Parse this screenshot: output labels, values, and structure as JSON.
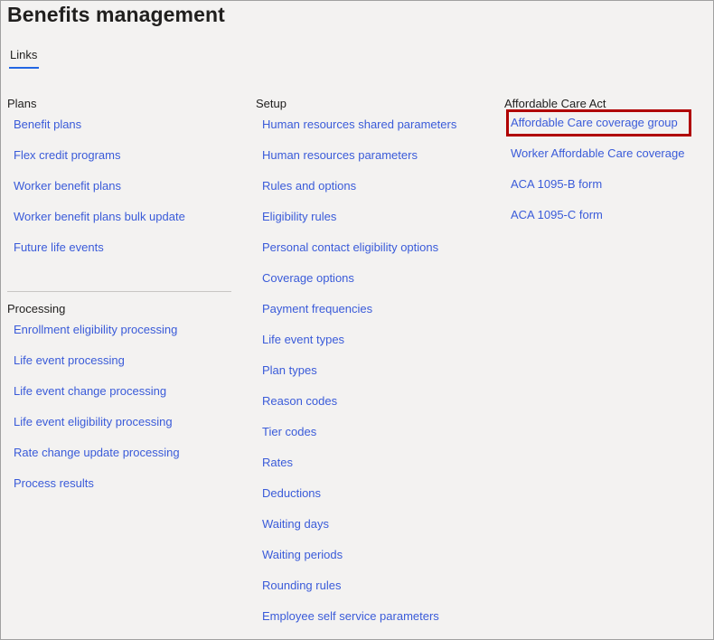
{
  "page": {
    "title": "Benefits management"
  },
  "tabs": [
    {
      "label": "Links",
      "active": true
    }
  ],
  "colors": {
    "link": "#3a5bd9",
    "tab_underline": "#2266e3",
    "highlight_border": "#b00000",
    "background": "#f3f2f1"
  },
  "sections": {
    "plans": {
      "title": "Plans",
      "links": [
        "Benefit plans",
        "Flex credit programs",
        "Worker benefit plans",
        "Worker benefit plans bulk update",
        "Future life events"
      ]
    },
    "processing": {
      "title": "Processing",
      "links": [
        "Enrollment eligibility processing",
        "Life event processing",
        "Life event change processing",
        "Life event eligibility processing",
        "Rate change update processing",
        "Process results"
      ]
    },
    "setup": {
      "title": "Setup",
      "links": [
        "Human resources shared parameters",
        "Human resources parameters",
        "Rules and options",
        "Eligibility rules",
        "Personal contact eligibility options",
        "Coverage options",
        "Payment frequencies",
        "Life event types",
        "Plan types",
        "Reason codes",
        "Tier codes",
        "Rates",
        "Deductions",
        "Waiting days",
        "Waiting periods",
        "Rounding rules",
        "Employee self service parameters"
      ]
    },
    "aca": {
      "title": "Affordable Care Act",
      "highlighted_index": 0,
      "links": [
        "Affordable Care coverage group",
        "Worker Affordable Care coverage",
        "ACA 1095-B form",
        "ACA 1095-C form"
      ]
    }
  }
}
